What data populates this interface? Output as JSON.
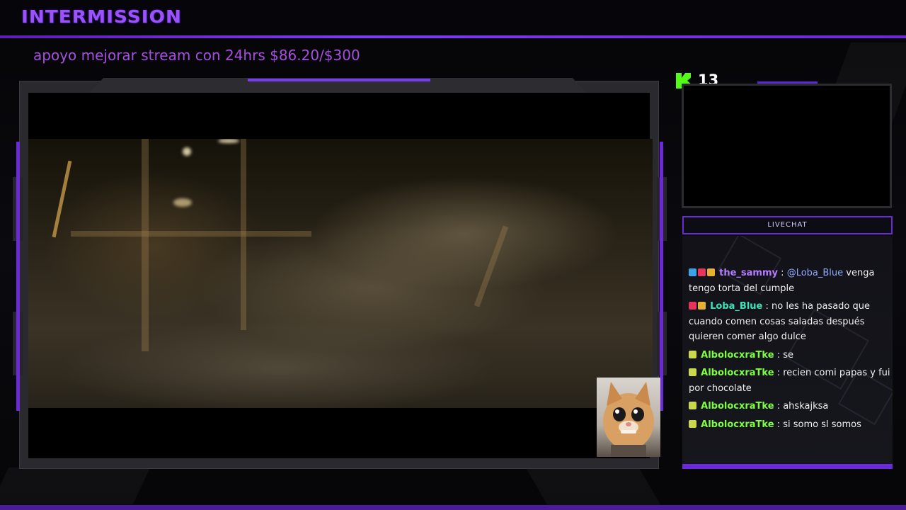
{
  "header": {
    "title": "INTERMISSION",
    "goal": "apoyo mejorar stream con 24hrs $86.20/$300"
  },
  "kick": {
    "logo": "kick-logo-icon",
    "viewer_count": "13"
  },
  "livechat": {
    "title": "LIVECHAT",
    "messages": [
      {
        "badges": [
          "verified-badge",
          "heart-badge",
          "crown-badge"
        ],
        "username": "the_sammy",
        "user_color": "#b57cff",
        "separator": ":",
        "mention": "@Loba_Blue",
        "text": " venga tengo torta del cumple"
      },
      {
        "badges": [
          "heart-badge",
          "crown-badge"
        ],
        "username": "Loba_Blue",
        "user_color": "#3de3b8",
        "separator": ":",
        "mention": "",
        "text": " no les ha pasado que cuando comen cosas saladas después quieren comer algo dulce"
      },
      {
        "badges": [
          "cat-badge"
        ],
        "username": "AlbolocxraTke",
        "user_color": "#7dff3d",
        "separator": ":",
        "mention": "",
        "text": " se"
      },
      {
        "badges": [
          "cat-badge"
        ],
        "username": "AlbolocxraTke",
        "user_color": "#7dff3d",
        "separator": ":",
        "mention": "",
        "text": " recien comi papas y fui por chocolate"
      },
      {
        "badges": [
          "cat-badge"
        ],
        "username": "AlbolocxraTke",
        "user_color": "#7dff3d",
        "separator": ":",
        "mention": "",
        "text": " ahskajksa"
      },
      {
        "badges": [
          "cat-badge"
        ],
        "username": "AlbolocxraTke",
        "user_color": "#7dff3d",
        "separator": ":",
        "mention": "",
        "text": " si somo sl somos"
      }
    ]
  },
  "colors": {
    "accent": "#6a2ad8",
    "title": "#9a52ff",
    "goal": "#a54ee0",
    "kick_green": "#53fc18",
    "mention": "#8fa8ff"
  }
}
